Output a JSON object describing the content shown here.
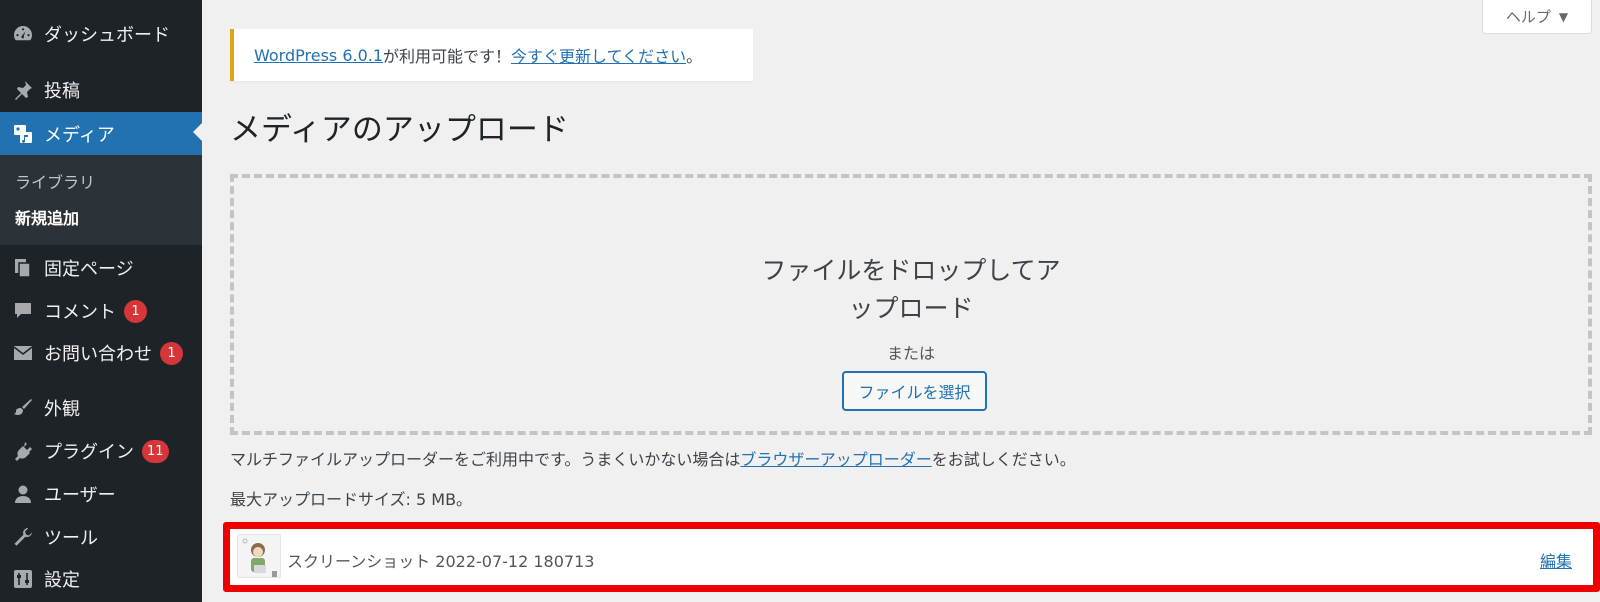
{
  "sidebar": {
    "items": [
      {
        "label": "ダッシュボード",
        "icon": "dashboard-icon"
      },
      {
        "label": "投稿",
        "icon": "pushpin-icon"
      },
      {
        "label": "メディア",
        "icon": "media-icon"
      },
      {
        "label": "固定ページ",
        "icon": "pages-icon"
      },
      {
        "label": "コメント",
        "icon": "comment-icon",
        "badge": "1"
      },
      {
        "label": "お問い合わせ",
        "icon": "mail-icon",
        "badge": "1"
      },
      {
        "label": "外観",
        "icon": "paintbrush-icon"
      },
      {
        "label": "プラグイン",
        "icon": "plugin-icon",
        "badge": "11"
      },
      {
        "label": "ユーザー",
        "icon": "user-icon"
      },
      {
        "label": "ツール",
        "icon": "wrench-icon"
      },
      {
        "label": "設定",
        "icon": "settings-icon"
      }
    ],
    "submenu": [
      {
        "label": "ライブラリ"
      },
      {
        "label": "新規追加"
      }
    ]
  },
  "help": {
    "label": "ヘルプ",
    "caret": "▼"
  },
  "notice": {
    "link_version": "WordPress 6.0.1",
    "text_mid": " が利用可能です！",
    "link_update": "今すぐ更新してください",
    "text_end": "。"
  },
  "page": {
    "title": "メディアのアップロード"
  },
  "dropzone": {
    "line1": "ファイルをドロップしてア",
    "line2": "ップロード",
    "or": "または",
    "button": "ファイルを選択"
  },
  "info": {
    "multi_prefix": "マルチファイルアップローダーをご利用中です。うまくいかない場合は",
    "browser_link": "ブラウザーアップローダー",
    "multi_suffix": "をお試しください。",
    "max_size": "最大アップロードサイズ: 5 MB。"
  },
  "upload": {
    "filename": "スクリーンショット 2022-07-12 180713",
    "edit": "編集"
  },
  "colors": {
    "sidebar_bg": "#1d2327",
    "accent": "#2271b1",
    "badge": "#d63638",
    "notice_border": "#dba617",
    "highlight": "#ef0000"
  }
}
